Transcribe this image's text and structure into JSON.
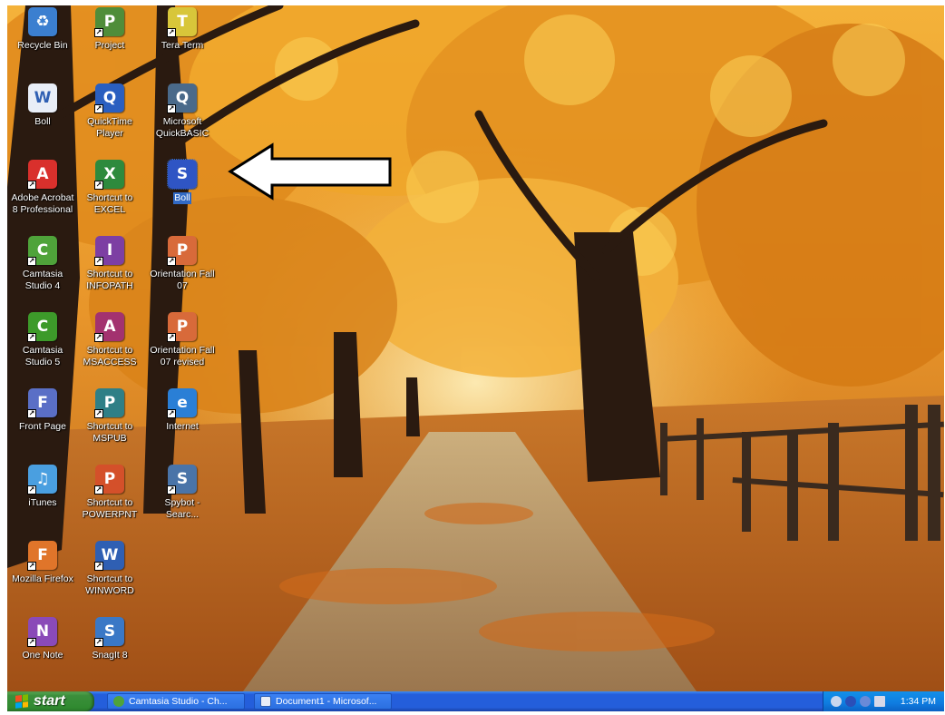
{
  "desktop": {
    "icons": [
      {
        "name": "recycle-bin",
        "label": "Recycle Bin",
        "glyph": "♻",
        "color": "#3b7fd0",
        "shortcut": false
      },
      {
        "name": "project",
        "label": "Project",
        "glyph": "P",
        "color": "#4f8d3a",
        "shortcut": true
      },
      {
        "name": "tera-term",
        "label": "Tera Term",
        "glyph": "T",
        "color": "#d8c63a",
        "shortcut": true
      },
      {
        "name": "boll-document",
        "label": "Boll",
        "glyph": "W",
        "color": "#e9eef7",
        "shortcut": false
      },
      {
        "name": "quicktime-player",
        "label": "QuickTime\nPlayer",
        "glyph": "Q",
        "color": "#2a5fc0",
        "shortcut": true
      },
      {
        "name": "microsoft-quickbasic",
        "label": "Microsoft\nQuickBASIC",
        "glyph": "Q",
        "color": "#4a6a8a",
        "shortcut": true
      },
      {
        "name": "adobe-acrobat",
        "label": "Adobe Acrobat\n8 Professional",
        "glyph": "A",
        "color": "#d9302c",
        "shortcut": true
      },
      {
        "name": "shortcut-excel",
        "label": "Shortcut to\nEXCEL",
        "glyph": "X",
        "color": "#2d8a3d",
        "shortcut": true
      },
      {
        "name": "boll-skype",
        "label": "Boll",
        "glyph": "S",
        "color": "#2f55c4",
        "shortcut": false,
        "selected": true
      },
      {
        "name": "camtasia-studio-4",
        "label": "Camtasia\nStudio 4",
        "glyph": "C",
        "color": "#4fa33a",
        "shortcut": true
      },
      {
        "name": "shortcut-infopath",
        "label": "Shortcut to\nINFOPATH",
        "glyph": "I",
        "color": "#7d3fa3",
        "shortcut": true
      },
      {
        "name": "orientation-fall-07",
        "label": "Orientation Fall\n07",
        "glyph": "P",
        "color": "#d86a3a",
        "shortcut": true
      },
      {
        "name": "camtasia-studio-5",
        "label": "Camtasia\nStudio 5",
        "glyph": "C",
        "color": "#3d9a2a",
        "shortcut": true
      },
      {
        "name": "shortcut-msaccess",
        "label": "Shortcut to\nMSACCESS",
        "glyph": "A",
        "color": "#a3326f",
        "shortcut": true
      },
      {
        "name": "orientation-fall-07-revised",
        "label": "Orientation Fall\n07 revised",
        "glyph": "P",
        "color": "#d86a3a",
        "shortcut": true
      },
      {
        "name": "front-page",
        "label": "Front Page",
        "glyph": "F",
        "color": "#5a6fc6",
        "shortcut": true
      },
      {
        "name": "shortcut-mspub",
        "label": "Shortcut to\nMSPUB",
        "glyph": "P",
        "color": "#2f7f86",
        "shortcut": true
      },
      {
        "name": "internet",
        "label": "Internet",
        "glyph": "e",
        "color": "#2a7fd6",
        "shortcut": true
      },
      {
        "name": "itunes",
        "label": "iTunes",
        "glyph": "♫",
        "color": "#4a9fe0",
        "shortcut": true
      },
      {
        "name": "shortcut-powerpnt",
        "label": "Shortcut to\nPOWERPNT",
        "glyph": "P",
        "color": "#d4502a",
        "shortcut": true
      },
      {
        "name": "spybot-search",
        "label": "Spybot -\nSearc...",
        "glyph": "S",
        "color": "#4a74a8",
        "shortcut": true
      },
      {
        "name": "mozilla-firefox",
        "label": "Mozilla Firefox",
        "glyph": "F",
        "color": "#e0752a",
        "shortcut": true
      },
      {
        "name": "shortcut-winword",
        "label": "Shortcut to\nWINWORD",
        "glyph": "W",
        "color": "#2f5fb3",
        "shortcut": true
      },
      {
        "name": "one-note",
        "label": "One Note",
        "glyph": "N",
        "color": "#8a4ab8",
        "shortcut": true
      },
      {
        "name": "snagit-8",
        "label": "SnagIt 8",
        "glyph": "S",
        "color": "#3a78c6",
        "shortcut": true
      }
    ]
  },
  "taskbar": {
    "start_label": "start",
    "tasks": [
      {
        "name": "camtasia-studio",
        "label": "Camtasia Studio - Ch...",
        "color": "#4fa33a"
      },
      {
        "name": "document1-word",
        "label": "Document1 - Microsof...",
        "color": "#e9eef7"
      }
    ],
    "clock": "1:34 PM"
  }
}
